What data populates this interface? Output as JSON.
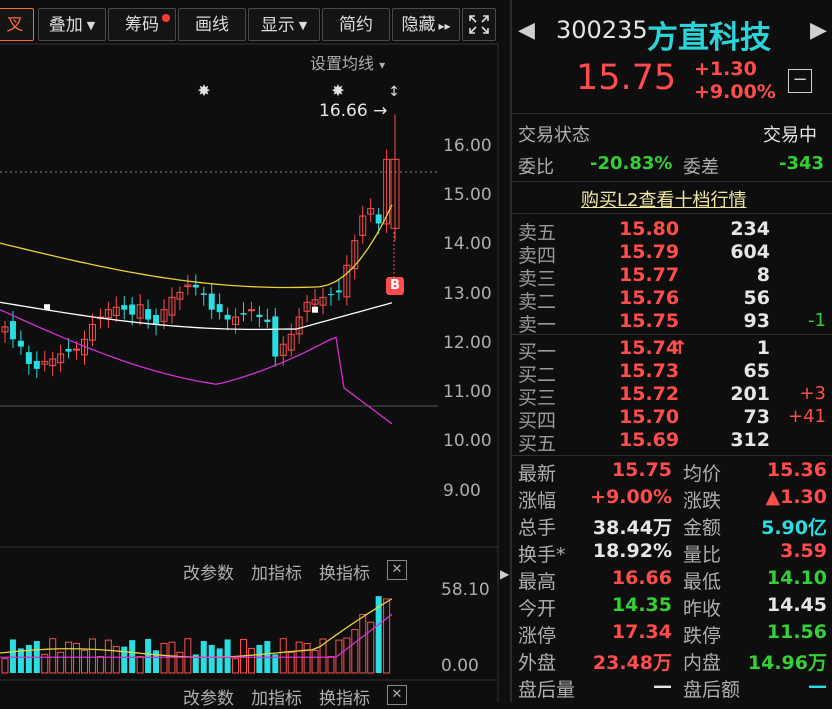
{
  "toolbar": {
    "fuquan": "叉",
    "overlay": "叠加",
    "chips": "筹码",
    "draw": "画线",
    "display": "显示",
    "simple": "简约",
    "hide": "隐藏",
    "hide_arrows": "▸▸",
    "expand_icon": "expand-icon"
  },
  "chart": {
    "ma_setting": "设置均线",
    "ma_setting_caret": "▾",
    "high_marker": "16.66",
    "high_arrow": "→",
    "buy_signal": "B",
    "y_ticks": [
      "16.00",
      "15.00",
      "14.00",
      "13.00",
      "12.00",
      "11.00",
      "10.00",
      "9.00"
    ],
    "volume_ticks": [
      "58.10",
      "0.00"
    ],
    "indicator_buttons": [
      "改参数",
      "加指标",
      "换指标"
    ],
    "close_glyph": "✕"
  },
  "chart_data": {
    "type": "candlestick",
    "y_range": [
      8.5,
      16.9
    ],
    "last_close": 15.75,
    "prev_close": 14.45,
    "high": 16.66,
    "low": 14.1,
    "open": 14.35,
    "volume_range": [
      0,
      58.1
    ],
    "colors": {
      "up": "#ff4d4d",
      "down": "#29dde0",
      "ma_white": "#ffffff",
      "boll_upper": "#e8d23a",
      "boll_lower": "#d62fd6",
      "vol_ma": "#e8d23a",
      "vol_ma2": "#d62fd6"
    }
  },
  "quote": {
    "code": "300235",
    "name": "方直科技",
    "price": "15.75",
    "change": "+1.30",
    "change_pct": "+9.00%",
    "minus_button": "−",
    "status_label": "交易状态",
    "status_value": "交易中",
    "wb_label": "委比",
    "wb_value": "-20.83%",
    "wc_label": "委差",
    "wc_value": "-343",
    "l2_link": "购买L2查看十档行情"
  },
  "sells": [
    {
      "label": "卖五",
      "price": "15.80",
      "vol": "234",
      "chg": ""
    },
    {
      "label": "卖四",
      "price": "15.79",
      "vol": "604",
      "chg": ""
    },
    {
      "label": "卖三",
      "price": "15.77",
      "vol": "8",
      "chg": ""
    },
    {
      "label": "卖二",
      "price": "15.76",
      "vol": "56",
      "chg": ""
    },
    {
      "label": "卖一",
      "price": "15.75",
      "vol": "93",
      "chg": "-1"
    }
  ],
  "buys": [
    {
      "label": "买一",
      "price": "15.74",
      "vol": "1",
      "chg": "",
      "arrow": "↑"
    },
    {
      "label": "买二",
      "price": "15.73",
      "vol": "65",
      "chg": "",
      "arrow": ""
    },
    {
      "label": "买三",
      "price": "15.72",
      "vol": "201",
      "chg": "+3",
      "arrow": ""
    },
    {
      "label": "买四",
      "price": "15.70",
      "vol": "73",
      "chg": "+41",
      "arrow": ""
    },
    {
      "label": "买五",
      "price": "15.69",
      "vol": "312",
      "chg": "",
      "arrow": ""
    }
  ],
  "stats": [
    {
      "l1": "最新",
      "v1": "15.75",
      "c1": "red",
      "l2": "均价",
      "v2": "15.36",
      "c2": "red"
    },
    {
      "l1": "涨幅",
      "v1": "+9.00%",
      "c1": "red",
      "l2": "涨跌",
      "v2": "▲1.30",
      "c2": "red"
    },
    {
      "l1": "总手",
      "v1": "38.44万",
      "c1": "white",
      "l2": "金额",
      "v2": "5.90亿",
      "c2": "cyan"
    },
    {
      "l1": "换手*",
      "v1": "18.92%",
      "c1": "white",
      "l2": "量比",
      "v2": "3.59",
      "c2": "red"
    },
    {
      "l1": "最高",
      "v1": "16.66",
      "c1": "red",
      "l2": "最低",
      "v2": "14.10",
      "c2": "green"
    },
    {
      "l1": "今开",
      "v1": "14.35",
      "c1": "green",
      "l2": "昨收",
      "v2": "14.45",
      "c2": "white"
    },
    {
      "l1": "涨停",
      "v1": "17.34",
      "c1": "red",
      "l2": "跌停",
      "v2": "11.56",
      "c2": "green"
    },
    {
      "l1": "外盘",
      "v1": "23.48万",
      "c1": "red",
      "l2": "内盘",
      "v2": "14.96万",
      "c2": "green"
    },
    {
      "l1": "盘后量",
      "v1": "—",
      "c1": "white",
      "l2": "盘后额",
      "v2": "—",
      "c2": "cyan"
    }
  ]
}
